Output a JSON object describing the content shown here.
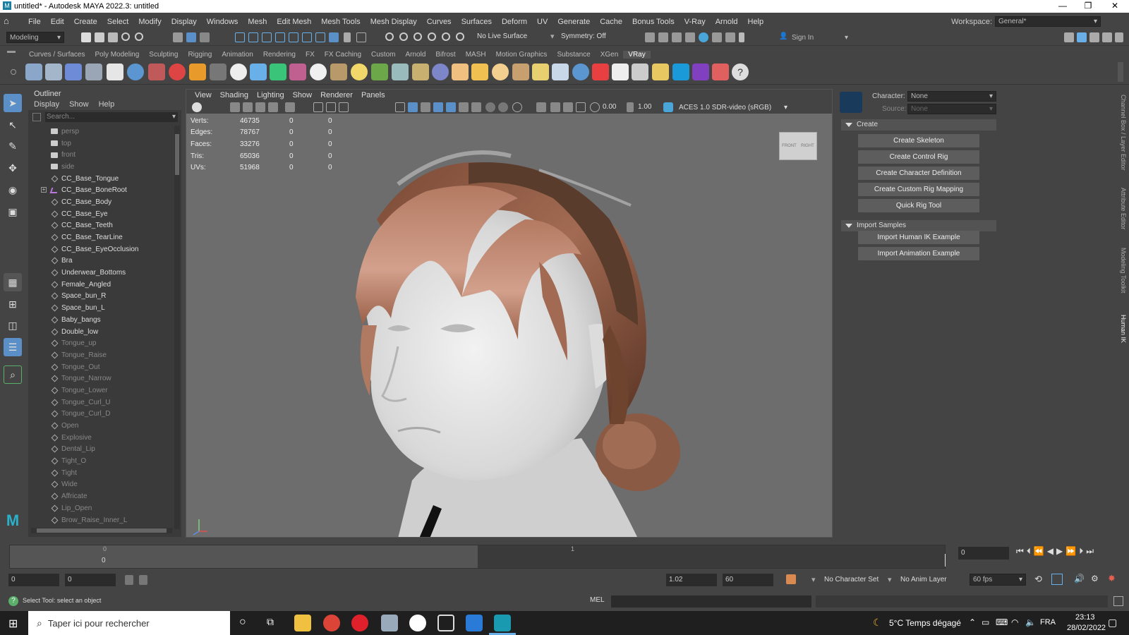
{
  "window": {
    "title": "untitled* - Autodesk MAYA 2022.3: untitled",
    "minimize": "—",
    "maximize": "❐",
    "close": "✕"
  },
  "menubar": {
    "items": [
      "File",
      "Edit",
      "Create",
      "Select",
      "Modify",
      "Display",
      "Windows",
      "Mesh",
      "Edit Mesh",
      "Mesh Tools",
      "Mesh Display",
      "Curves",
      "Surfaces",
      "Deform",
      "UV",
      "Generate",
      "Cache",
      "Bonus Tools",
      "V-Ray",
      "Arnold",
      "Help"
    ],
    "workspace_label": "Workspace:",
    "workspace_value": "General*"
  },
  "statusline": {
    "mode": "Modeling",
    "live_surface": "No Live Surface",
    "symmetry": "Symmetry: Off",
    "sign_in": "Sign In"
  },
  "shelf": {
    "tabs": [
      "Curves / Surfaces",
      "Poly Modeling",
      "Sculpting",
      "Rigging",
      "Animation",
      "Rendering",
      "FX",
      "FX Caching",
      "Custom",
      "Arnold",
      "Bifrost",
      "MASH",
      "Motion Graphics",
      "Substance",
      "XGen",
      "VRay"
    ],
    "active": "VRay"
  },
  "outliner": {
    "title": "Outliner",
    "menu": [
      "Display",
      "Show",
      "Help"
    ],
    "search_placeholder": "Search...",
    "items": [
      {
        "name": "persp",
        "type": "cam",
        "dim": true
      },
      {
        "name": "top",
        "type": "cam",
        "dim": true
      },
      {
        "name": "front",
        "type": "cam",
        "dim": true
      },
      {
        "name": "side",
        "type": "cam",
        "dim": true
      },
      {
        "name": "CC_Base_Tongue",
        "type": "mesh",
        "dim": false
      },
      {
        "name": "CC_Base_BoneRoot",
        "type": "joint",
        "dim": false,
        "expand": true
      },
      {
        "name": "CC_Base_Body",
        "type": "mesh",
        "dim": false
      },
      {
        "name": "CC_Base_Eye",
        "type": "mesh",
        "dim": false
      },
      {
        "name": "CC_Base_Teeth",
        "type": "mesh",
        "dim": false
      },
      {
        "name": "CC_Base_TearLine",
        "type": "mesh",
        "dim": false
      },
      {
        "name": "CC_Base_EyeOcclusion",
        "type": "mesh",
        "dim": false
      },
      {
        "name": "Bra",
        "type": "mesh",
        "dim": false
      },
      {
        "name": "Underwear_Bottoms",
        "type": "mesh",
        "dim": false
      },
      {
        "name": "Female_Angled",
        "type": "mesh",
        "dim": false
      },
      {
        "name": "Space_bun_R",
        "type": "mesh",
        "dim": false
      },
      {
        "name": "Space_bun_L",
        "type": "mesh",
        "dim": false
      },
      {
        "name": "Baby_bangs",
        "type": "mesh",
        "dim": false
      },
      {
        "name": "Double_low",
        "type": "mesh",
        "dim": false
      },
      {
        "name": "Tongue_up",
        "type": "mesh",
        "dim": true
      },
      {
        "name": "Tongue_Raise",
        "type": "mesh",
        "dim": true
      },
      {
        "name": "Tongue_Out",
        "type": "mesh",
        "dim": true
      },
      {
        "name": "Tongue_Narrow",
        "type": "mesh",
        "dim": true
      },
      {
        "name": "Tongue_Lower",
        "type": "mesh",
        "dim": true
      },
      {
        "name": "Tongue_Curl_U",
        "type": "mesh",
        "dim": true
      },
      {
        "name": "Tongue_Curl_D",
        "type": "mesh",
        "dim": true
      },
      {
        "name": "Open",
        "type": "mesh",
        "dim": true
      },
      {
        "name": "Explosive",
        "type": "mesh",
        "dim": true
      },
      {
        "name": "Dental_Lip",
        "type": "mesh",
        "dim": true
      },
      {
        "name": "Tight_O",
        "type": "mesh",
        "dim": true
      },
      {
        "name": "Tight",
        "type": "mesh",
        "dim": true
      },
      {
        "name": "Wide",
        "type": "mesh",
        "dim": true
      },
      {
        "name": "Affricate",
        "type": "mesh",
        "dim": true
      },
      {
        "name": "Lip_Open",
        "type": "mesh",
        "dim": true
      },
      {
        "name": "Brow_Raise_Inner_L",
        "type": "mesh",
        "dim": true
      }
    ]
  },
  "viewport": {
    "menu": [
      "View",
      "Shading",
      "Lighting",
      "Show",
      "Renderer",
      "Panels"
    ],
    "exposure": "0.00",
    "gamma": "1.00",
    "color_space": "ACES 1.0 SDR-video (sRGB)",
    "hud": [
      {
        "label": "Verts:",
        "v1": "46735",
        "v2": "0",
        "v3": "0"
      },
      {
        "label": "Edges:",
        "v1": "78767",
        "v2": "0",
        "v3": "0"
      },
      {
        "label": "Faces:",
        "v1": "33276",
        "v2": "0",
        "v3": "0"
      },
      {
        "label": "Tris:",
        "v1": "65036",
        "v2": "0",
        "v3": "0"
      },
      {
        "label": "UVs:",
        "v1": "51968",
        "v2": "0",
        "v3": "0"
      }
    ],
    "viewcube": {
      "front": "FRONT",
      "right": "RIGHT"
    }
  },
  "hik": {
    "character_label": "Character:",
    "character_value": "None",
    "source_label": "Source:",
    "source_value": "None",
    "create_section": "Create",
    "create_buttons": [
      "Create Skeleton",
      "Create Control Rig",
      "Create Character Definition",
      "Create Custom Rig Mapping",
      "Quick Rig Tool"
    ],
    "import_section": "Import Samples",
    "import_buttons": [
      "Import Human IK Example",
      "Import Animation Example"
    ]
  },
  "right_tabs": [
    "Channel Box / Layer Editor",
    "Attribute Editor",
    "Modeling Toolkit",
    "Human IK"
  ],
  "timeslider": {
    "top_tick": "0",
    "mid_tick": "1",
    "frame_label": "0",
    "current_frame": "0"
  },
  "range": {
    "start": "0",
    "start2": "0",
    "end_value": "1.02",
    "end": "60",
    "character_set": "No Character Set",
    "anim_layer": "No Anim Layer",
    "fps": "60 fps"
  },
  "cmdline": {
    "status": "Select Tool: select an object",
    "lang": "MEL"
  },
  "taskbar": {
    "search_placeholder": "Taper ici pour rechercher",
    "weather": "5°C  Temps dégagé",
    "lang": "FRA",
    "time": "23:13",
    "date": "28/02/2022"
  }
}
